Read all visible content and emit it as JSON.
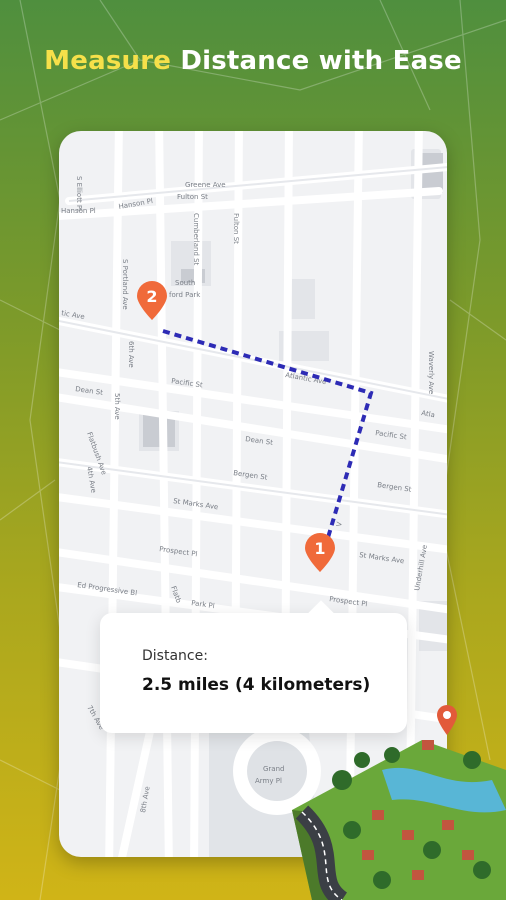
{
  "headline": {
    "accent": "Measure",
    "rest": " Distance with Ease"
  },
  "map": {
    "streets": {
      "s_elliott_pl": "S Elliott Pl",
      "hanson_pl": "Hanson Pl",
      "greene_ave": "Greene Ave",
      "fulton_st": "Fulton St",
      "cumberland_st": "Cumberland St",
      "south_oxford_park_1": "South",
      "south_oxford_park_2": "ford Park",
      "s_portland_ave": "S Portland Ave",
      "atlantic_ave_left": "tic Ave",
      "atlantic_ave_mid": "Atlantic Ave",
      "atlantic_ave_right": "Atla",
      "pacific_st": "Pacific St",
      "pacific_st_right": "Pacific St",
      "dean_st": "Dean St",
      "dean_st_mid": "Dean St",
      "bergen_st": "Bergen St",
      "bergen_st_right": "Bergen St",
      "st_marks_ave": "St Marks Ave",
      "st_marks_ave_right": "St Marks Ave",
      "prospect_pl": "Prospect Pl",
      "prospect_pl_right": "Prospect Pl",
      "flatbush_ave": "Flatbush Ave",
      "sixth_ave": "6th Ave",
      "fifth_ave": "5th Ave",
      "fourth_ave": "4th Ave",
      "park_pl": "Park Pl",
      "ed_prog": "Ed Progressive Bl",
      "waverly_ave": "Waverly Ave",
      "underhill_ave": "Underhill Ave",
      "grand_army_1": "Grand",
      "grand_army_2": "Army Pl",
      "seventh_ave": "7th Ave",
      "eighth_ave": "8th Ave",
      "flatb": "Flatb",
      "vanderbilt": "Vanderbilt Ave",
      "vand_short": "V"
    },
    "pins": [
      {
        "label": "1",
        "color": "#f06a3a"
      },
      {
        "label": "2",
        "color": "#f06a3a"
      }
    ],
    "route_color": "#2d2bb5"
  },
  "distance_card": {
    "label": "Distance:",
    "value": "2.5 miles (4 kilometers)"
  },
  "colors": {
    "accent": "#f6e04a",
    "pin": "#f06a3a"
  }
}
